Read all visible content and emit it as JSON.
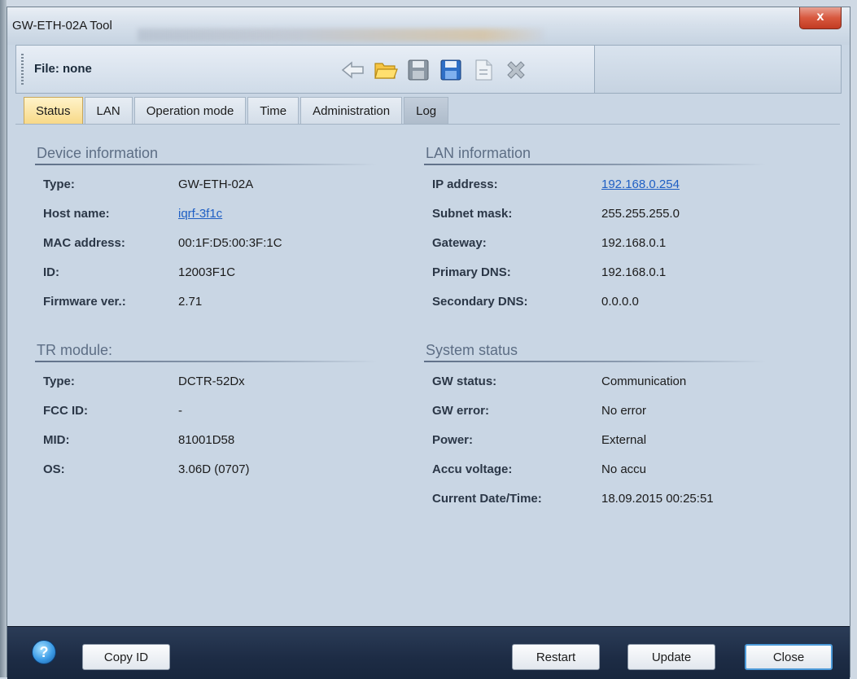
{
  "window": {
    "title": "GW-ETH-02A Tool",
    "close_glyph": "x"
  },
  "toolbar": {
    "file_label": "File: none",
    "icons": [
      "back-arrow-icon",
      "open-folder-icon",
      "save-icon",
      "save-as-icon",
      "document-icon",
      "delete-icon"
    ]
  },
  "tabs": [
    {
      "label": "Status",
      "active": true
    },
    {
      "label": "LAN"
    },
    {
      "label": "Operation mode"
    },
    {
      "label": "Time"
    },
    {
      "label": "Administration"
    },
    {
      "label": "Log"
    }
  ],
  "device_info": {
    "title": "Device information",
    "rows": [
      {
        "label": "Type:",
        "value": "GW-ETH-02A"
      },
      {
        "label": "Host name:",
        "value": "iqrf-3f1c",
        "link": true
      },
      {
        "label": "MAC address:",
        "value": "00:1F:D5:00:3F:1C"
      },
      {
        "label": "ID:",
        "value": "12003F1C"
      },
      {
        "label": "Firmware ver.:",
        "value": "2.71"
      }
    ]
  },
  "tr_module": {
    "title": "TR module:",
    "rows": [
      {
        "label": "Type:",
        "value": "DCTR-52Dx"
      },
      {
        "label": "FCC ID:",
        "value": "-"
      },
      {
        "label": "MID:",
        "value": "81001D58"
      },
      {
        "label": "OS:",
        "value": "3.06D (0707)"
      }
    ]
  },
  "lan_info": {
    "title": "LAN information",
    "rows": [
      {
        "label": "IP address:",
        "value": "192.168.0.254",
        "link": true
      },
      {
        "label": "Subnet mask:",
        "value": "255.255.255.0"
      },
      {
        "label": "Gateway:",
        "value": "192.168.0.1"
      },
      {
        "label": "Primary DNS:",
        "value": "192.168.0.1"
      },
      {
        "label": "Secondary DNS:",
        "value": "0.0.0.0"
      }
    ]
  },
  "system_status": {
    "title": "System status",
    "rows": [
      {
        "label": "GW status:",
        "value": "Communication"
      },
      {
        "label": "GW error:",
        "value": "No error"
      },
      {
        "label": "Power:",
        "value": "External"
      },
      {
        "label": "Accu voltage:",
        "value": "No accu"
      },
      {
        "label": "Current Date/Time:",
        "value": "18.09.2015 00:25:51"
      }
    ]
  },
  "buttons": {
    "help_glyph": "?",
    "copy_id": "Copy ID",
    "restart": "Restart",
    "update": "Update",
    "close": "Close"
  }
}
